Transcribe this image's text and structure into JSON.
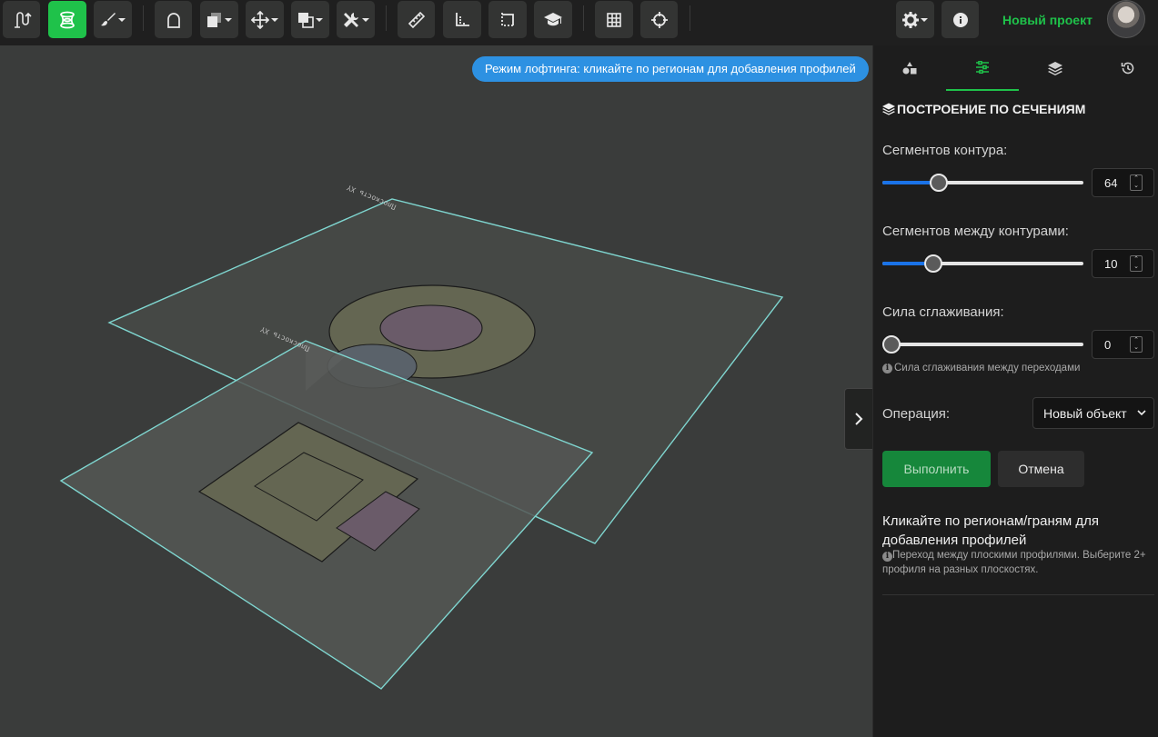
{
  "toolbar": {
    "items": [
      {
        "id": "sketch",
        "icon": "sketch-extrude-icon"
      },
      {
        "id": "loft",
        "icon": "loft-icon",
        "active": true
      },
      {
        "id": "brush",
        "icon": "brush-icon",
        "dropdown": true
      },
      {
        "id": "arch",
        "icon": "arch-icon"
      },
      {
        "id": "boolean",
        "icon": "boolean-icon",
        "dropdown": true
      },
      {
        "id": "move",
        "icon": "move-icon",
        "dropdown": true
      },
      {
        "id": "duplicate",
        "icon": "duplicate-icon",
        "dropdown": true
      },
      {
        "id": "tools",
        "icon": "tools-icon",
        "dropdown": true
      },
      {
        "id": "ruler",
        "icon": "ruler-icon"
      },
      {
        "id": "angle-measure",
        "icon": "angle-ruler-icon"
      },
      {
        "id": "crop",
        "icon": "crop-frame-icon"
      },
      {
        "id": "learn",
        "icon": "graduation-cap-icon"
      },
      {
        "id": "grid",
        "icon": "grid-icon"
      },
      {
        "id": "snap",
        "icon": "crosshair-icon"
      },
      {
        "id": "settings",
        "icon": "gear-icon",
        "dropdown": true
      },
      {
        "id": "info",
        "icon": "info-icon"
      }
    ],
    "project_name": "Новый проект",
    "accent_color": "#1fc24a"
  },
  "viewport": {
    "mode_banner": "Режим лофтинга: кликайте по регионам для добавления профилей",
    "plane_labels": {
      "upper": "Плоскость XY",
      "lower": "Плоскость XY"
    }
  },
  "panel": {
    "tabs": [
      {
        "icon": "shapes-icon"
      },
      {
        "icon": "sliders-icon",
        "active": true
      },
      {
        "icon": "layers-icon"
      },
      {
        "icon": "history-icon"
      }
    ],
    "section_title": "ПОСТРОЕНИЕ ПО СЕЧЕНИЯМ",
    "fields": {
      "contour_segments": {
        "label": "Сегментов контура:",
        "value": "64",
        "fraction": 0.26
      },
      "between_segments": {
        "label": "Сегментов между контурами:",
        "value": "10",
        "fraction": 0.23
      },
      "smoothing": {
        "label": "Сила сглаживания:",
        "value": "0",
        "fraction": 0.0,
        "hint": "Сила сглаживания между переходами"
      }
    },
    "operation": {
      "label": "Операция:",
      "selected": "Новый объект"
    },
    "buttons": {
      "execute": "Выполнить",
      "cancel": "Отмена"
    },
    "instruction": "Кликайте по регионам/граням для добавления профилей",
    "instruction_hint": "Переход между плоскими профилями. Выберите 2+ профиля на разных плоскостях.",
    "slider_color": "#1a73e8"
  }
}
